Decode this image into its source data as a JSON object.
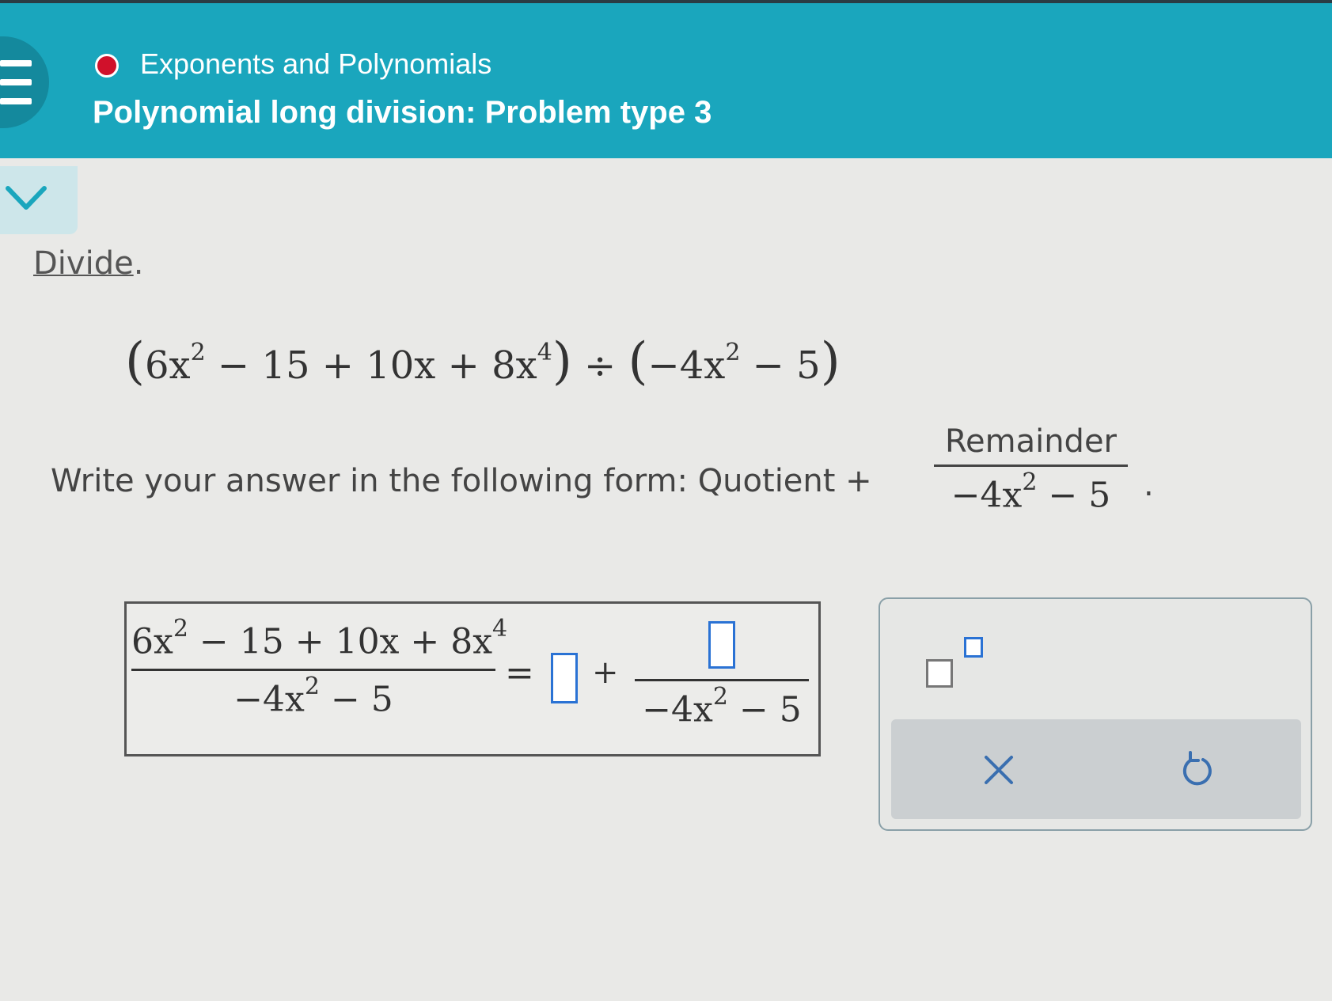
{
  "header": {
    "topic": "Exponents and Polynomials",
    "title": "Polynomial long division: Problem type 3",
    "status_color": "#d0112b",
    "bg_color": "#1aa6bd"
  },
  "question": {
    "instruction_link": "Divide",
    "instruction_end": ".",
    "problem": {
      "open": "(",
      "c1": "6x",
      "e1": "2",
      "t2": " − 15 + 10x + 8x",
      "e2": "4",
      "close": ")",
      "div": " ÷ ",
      "open2": "(",
      "t3": "−4x",
      "e3": "2",
      "t4": " − 5",
      "close2": ")"
    },
    "form_text": "Write your answer in the following form: Quotient +",
    "form_num": "Remainder",
    "form_den_a": "−4x",
    "form_den_e": "2",
    "form_den_b": " − 5",
    "form_end": "."
  },
  "answer": {
    "lhs_num_a": "6x",
    "lhs_num_e1": "2",
    "lhs_num_b": " − 15 + 10x + 8x",
    "lhs_num_e2": "4",
    "lhs_den_a": "−4x",
    "lhs_den_e": "2",
    "lhs_den_b": " − 5",
    "equals": "=",
    "plus": "+",
    "rhs_den_a": "−4x",
    "rhs_den_e": "2",
    "rhs_den_b": " − 5"
  },
  "keypad": {
    "exponent_icon": "superscript-template-icon",
    "clear_icon": "close-icon",
    "undo_icon": "undo-icon"
  }
}
